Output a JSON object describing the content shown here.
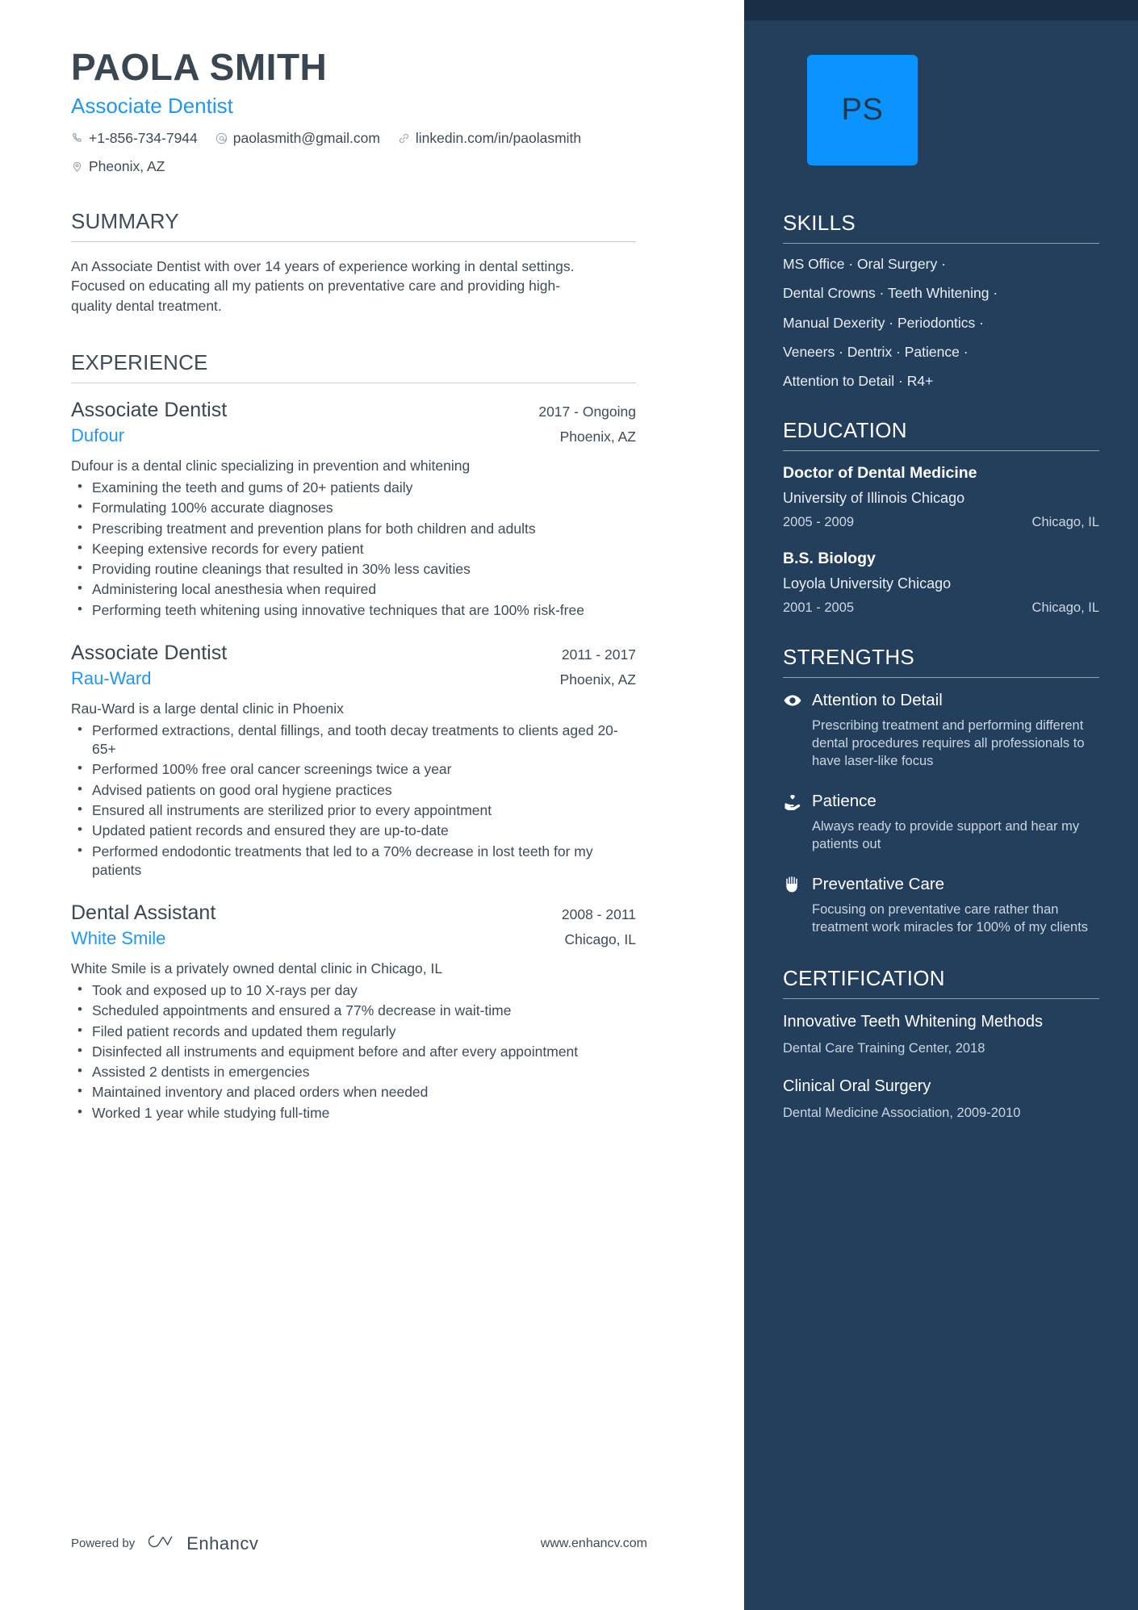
{
  "header": {
    "name": "PAOLA SMITH",
    "job_title": "Associate Dentist",
    "avatar_initials": "PS",
    "contacts": [
      {
        "icon": "phone-icon",
        "text": "+1-856-734-7944"
      },
      {
        "icon": "email-icon",
        "text": "paolasmith@gmail.com"
      },
      {
        "icon": "link-icon",
        "text": "linkedin.com/in/paolasmith"
      },
      {
        "icon": "location-pin-icon",
        "text": "Pheonix, AZ"
      }
    ]
  },
  "summary": {
    "heading": "SUMMARY",
    "text": "An Associate Dentist with over 14 years of experience working in dental settings. Focused on educating all my patients on preventative care and providing high-quality dental treatment."
  },
  "experience": {
    "heading": "EXPERIENCE",
    "items": [
      {
        "role": "Associate Dentist",
        "date": "2017 - Ongoing",
        "company": "Dufour",
        "location": "Phoenix, AZ",
        "blurb": "Dufour is a dental clinic specializing in prevention and whitening",
        "bullets": [
          "Examining the teeth and gums of 20+ patients daily",
          "Formulating 100% accurate diagnoses",
          "Prescribing treatment and prevention plans for both children and adults",
          "Keeping extensive records for every patient",
          "Providing routine cleanings that resulted in 30% less cavities",
          "Administering local anesthesia when required",
          "Performing teeth whitening using innovative techniques that are 100% risk-free"
        ]
      },
      {
        "role": "Associate Dentist",
        "date": "2011 - 2017",
        "company": "Rau-Ward",
        "location": "Phoenix, AZ",
        "blurb": "Rau-Ward is a large dental clinic in Phoenix",
        "bullets": [
          "Performed extractions, dental fillings, and tooth decay treatments to clients aged 20-65+",
          "Performed 100% free oral cancer screenings twice a year",
          "Advised patients on good oral hygiene practices",
          "Ensured all instruments are sterilized prior to every appointment",
          "Updated patient records and ensured they are up-to-date",
          "Performed endodontic treatments that led to a 70% decrease in lost teeth for my patients"
        ]
      },
      {
        "role": "Dental Assistant",
        "date": "2008 - 2011",
        "company": "White Smile",
        "location": "Chicago, IL",
        "blurb": "White Smile is a privately owned dental clinic in Chicago, IL",
        "bullets": [
          "Took and exposed up to 10 X-rays per day",
          "Scheduled appointments and ensured a 77% decrease in wait-time",
          "Filed patient records and updated them regularly",
          "Disinfected all instruments and equipment before and after every appointment",
          "Assisted 2 dentists in emergencies",
          "Maintained inventory and placed orders when needed",
          "Worked 1 year while studying full-time"
        ]
      }
    ]
  },
  "skills": {
    "heading": "SKILLS",
    "lines": [
      "MS Office · Oral Surgery ·",
      "Dental Crowns · Teeth Whitening ·",
      "Manual Dexerity · Periodontics ·",
      "Veneers · Dentrix  · Patience ·",
      "Attention to Detail · R4+"
    ]
  },
  "education": {
    "heading": "EDUCATION",
    "items": [
      {
        "degree": "Doctor of Dental Medicine",
        "school": "University of Illinois Chicago",
        "date": "2005 - 2009",
        "location": "Chicago, IL"
      },
      {
        "degree": "B.S. Biology",
        "school": "Loyola University Chicago",
        "date": "2001 - 2005",
        "location": "Chicago, IL"
      }
    ]
  },
  "strengths": {
    "heading": "STRENGTHS",
    "items": [
      {
        "icon": "eye-icon",
        "title": "Attention to Detail",
        "description": "Prescribing treatment and performing different dental procedures requires all professionals to have laser-like focus"
      },
      {
        "icon": "hand-holding-heart-icon",
        "title": "Patience",
        "description": "Always ready to provide support and hear my patients out"
      },
      {
        "icon": "raised-hand-icon",
        "title": "Preventative Care",
        "description": "Focusing on preventative care rather than treatment work miracles for 100% of my clients"
      }
    ]
  },
  "certification": {
    "heading": "CERTIFICATION",
    "items": [
      {
        "title": "Innovative Teeth Whitening Methods",
        "meta": "Dental Care Training Center, 2018"
      },
      {
        "title": "Clinical Oral Surgery",
        "meta": "Dental Medicine Association, 2009-2010"
      }
    ]
  },
  "footer": {
    "powered_by": "Powered by",
    "brand": "Enhancv",
    "url": "www.enhancv.com"
  },
  "colors": {
    "sidebar_bg": "#233f5c",
    "sidebar_top_strip": "#1a2e45",
    "accent_blue": "#2196f3",
    "avatar_bg": "#0b93ff",
    "heading_text": "#3f4b55"
  }
}
